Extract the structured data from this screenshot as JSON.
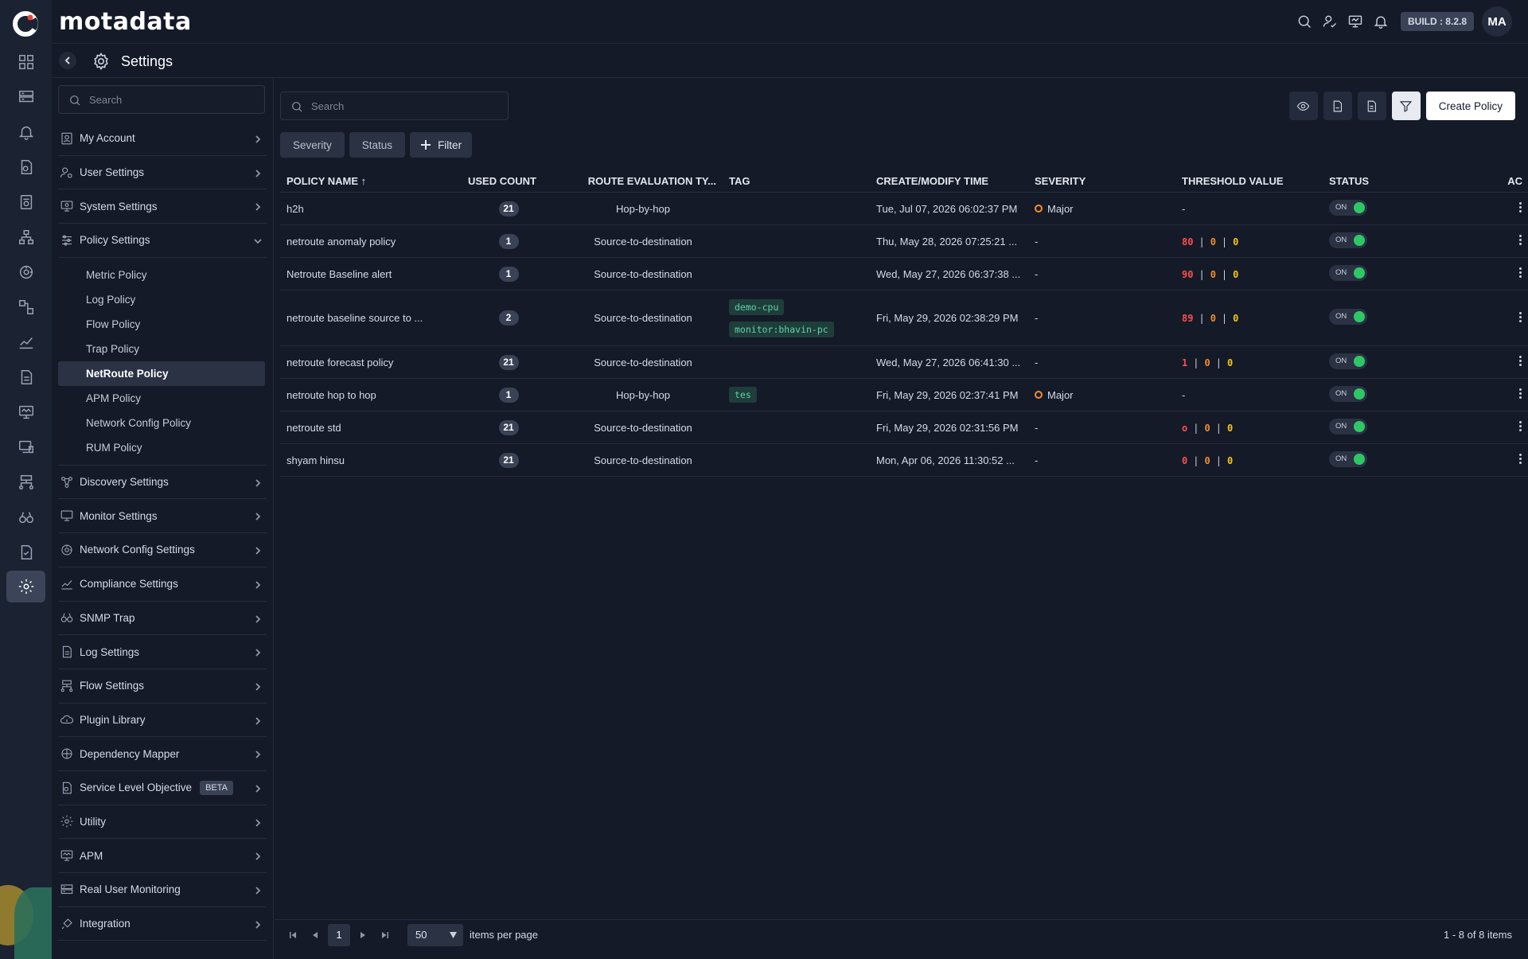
{
  "app": {
    "brand": "motadata",
    "build": "BUILD : 8.2.8",
    "user_initials": "MA"
  },
  "page": {
    "title": "Settings"
  },
  "nav": {
    "search_placeholder": "Search",
    "items": [
      {
        "label": "My Account",
        "icon": "user-card-icon"
      },
      {
        "label": "User Settings",
        "icon": "user-gear-icon"
      },
      {
        "label": "System Settings",
        "icon": "monitor-gear-icon"
      },
      {
        "label": "Policy Settings",
        "icon": "sliders-icon"
      },
      {
        "label": "Discovery Settings",
        "icon": "discovery-icon"
      },
      {
        "label": "Monitor Settings",
        "icon": "monitor-icon"
      },
      {
        "label": "Network Config Settings",
        "icon": "network-config-icon"
      },
      {
        "label": "Compliance Settings",
        "icon": "compliance-icon"
      },
      {
        "label": "SNMP Trap",
        "icon": "binoculars-icon"
      },
      {
        "label": "Log Settings",
        "icon": "document-icon"
      },
      {
        "label": "Flow Settings",
        "icon": "flow-icon"
      },
      {
        "label": "Plugin Library",
        "icon": "plugin-cloud-icon"
      },
      {
        "label": "Dependency Mapper",
        "icon": "dependency-icon"
      },
      {
        "label": "Service Level Objective",
        "icon": "slo-icon",
        "badge": "BETA"
      },
      {
        "label": "Utility",
        "icon": "utility-gear-icon"
      },
      {
        "label": "APM",
        "icon": "apm-icon"
      },
      {
        "label": "Real User Monitoring",
        "icon": "rum-icon"
      },
      {
        "label": "Integration",
        "icon": "integration-icon"
      }
    ],
    "policy_sub": [
      "Metric Policy",
      "Log Policy",
      "Flow Policy",
      "Trap Policy",
      "NetRoute Policy",
      "APM Policy",
      "Network Config Policy",
      "RUM Policy"
    ],
    "active_sub": "NetRoute Policy"
  },
  "toolbar": {
    "search_placeholder": "Search",
    "create_label": "Create Policy",
    "chips": [
      "Severity",
      "Status"
    ],
    "filter_label": "Filter"
  },
  "table": {
    "headers": {
      "name": "POLICY NAME ↑",
      "used": "USED COUNT",
      "route": "ROUTE EVALUATION TY...",
      "tag": "TAG",
      "time": "CREATE/MODIFY TIME",
      "severity": "SEVERITY",
      "threshold": "THRESHOLD VALUE",
      "status": "STATUS",
      "actions": "AC"
    },
    "rows": [
      {
        "name": "h2h",
        "used": "21",
        "route": "Hop-by-hop",
        "tags": [],
        "time": "Tue, Jul 07, 2026 06:02:37 PM",
        "severity": "Major",
        "threshold": null,
        "status": "ON"
      },
      {
        "name": "netroute anomaly policy",
        "used": "1",
        "route": "Source-to-destination",
        "tags": [],
        "time": "Thu, May 28, 2026 07:25:21 ...",
        "severity": "-",
        "threshold": [
          "80",
          "0",
          "0"
        ],
        "status": "ON"
      },
      {
        "name": "Netroute Baseline alert",
        "used": "1",
        "route": "Source-to-destination",
        "tags": [],
        "time": "Wed, May 27, 2026 06:37:38 ...",
        "severity": "-",
        "threshold": [
          "90",
          "0",
          "0"
        ],
        "status": "ON"
      },
      {
        "name": "netroute baseline source to ...",
        "used": "2",
        "route": "Source-to-destination",
        "tags": [
          "demo-cpu",
          "monitor:bhavin-pc"
        ],
        "time": "Fri, May 29, 2026 02:38:29 PM",
        "severity": "-",
        "threshold": [
          "89",
          "0",
          "0"
        ],
        "status": "ON"
      },
      {
        "name": "netroute forecast policy",
        "used": "21",
        "route": "Source-to-destination",
        "tags": [],
        "time": "Wed, May 27, 2026 06:41:30 ...",
        "severity": "-",
        "threshold": [
          "1",
          "0",
          "0"
        ],
        "status": "ON"
      },
      {
        "name": "netroute hop to hop",
        "used": "1",
        "route": "Hop-by-hop",
        "tags": [
          "tes"
        ],
        "time": "Fri, May 29, 2026 02:37:41 PM",
        "severity": "Major",
        "threshold": null,
        "status": "ON"
      },
      {
        "name": "netroute std",
        "used": "21",
        "route": "Source-to-destination",
        "tags": [],
        "time": "Fri, May 29, 2026 02:31:56 PM",
        "severity": "-",
        "threshold": [
          "o",
          "0",
          "0"
        ],
        "status": "ON"
      },
      {
        "name": "shyam hinsu",
        "used": "21",
        "route": "Source-to-destination",
        "tags": [],
        "time": "Mon, Apr 06, 2026 11:30:52 ...",
        "severity": "-",
        "threshold": [
          "0",
          "0",
          "0"
        ],
        "status": "ON"
      }
    ],
    "threshold_colors": [
      "#ff4d4f",
      "#f58b2d",
      "#f5c518"
    ],
    "dash": "-"
  },
  "pager": {
    "page": "1",
    "page_size": "50",
    "items_label": "items per page",
    "info": "1 - 8 of 8 items"
  },
  "colors": {
    "accent_on": "#2ec765",
    "severity_major": "#f58b2d",
    "tag_text": "#5fd3a8"
  }
}
